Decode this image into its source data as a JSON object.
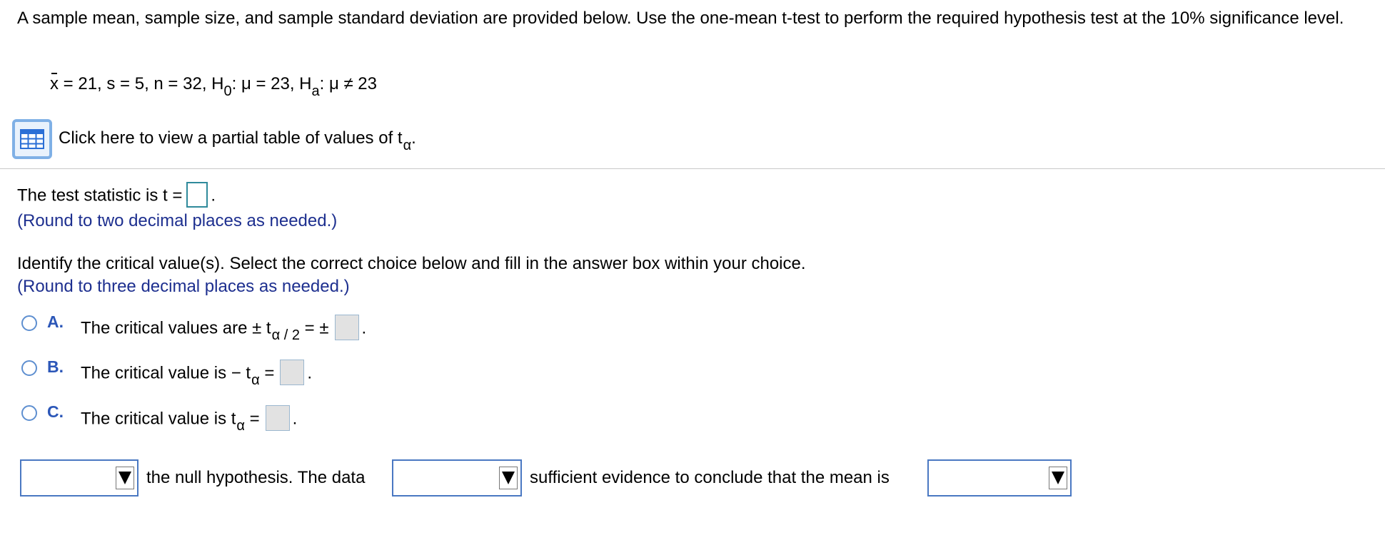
{
  "problem": {
    "intro": "A sample mean, sample size, and sample standard deviation are provided below. Use the one-mean t-test to perform the required hypothesis test at the 10% significance level.",
    "given": {
      "xbar_symbol": "x",
      "part1": " = 21, s = 5, n = 32, H",
      "h0_sub": "0",
      "part2": ": μ = 23, H",
      "ha_sub": "a",
      "part3": ": μ ≠ 23"
    },
    "table_link": {
      "text": "Click here to view a partial table of values of t",
      "sub": "α",
      "suffix": "."
    }
  },
  "test_statistic": {
    "label": "The test statistic is t =",
    "suffix": ".",
    "value": "",
    "round_note": "(Round to two decimal places as needed.)"
  },
  "critical": {
    "question": "Identify the critical value(s). Select the correct choice below and fill in the answer box within your choice.",
    "round_note": "(Round to three decimal places as needed.)",
    "choices": [
      {
        "letter": "A.",
        "text": "The critical values are  ± t",
        "sub": "α / 2",
        "after": " = ±",
        "suffix": "."
      },
      {
        "letter": "B.",
        "text": "The critical value is  − t",
        "sub": "α",
        "after": " =",
        "suffix": "."
      },
      {
        "letter": "C.",
        "text": "The critical value is t",
        "sub": "α",
        "after": " =",
        "suffix": "."
      }
    ]
  },
  "conclusion": {
    "segment1": "the null hypothesis. The data",
    "segment2": "sufficient evidence to conclude that the mean is",
    "dropdown1": "",
    "dropdown2": "",
    "dropdown3": ""
  },
  "colors": {
    "note_blue": "#1d2f8f",
    "radio_border": "#5e8fd0",
    "choice_letter": "#2c57b8",
    "answer_box_border": "#2f8a9b",
    "dropdown_border": "#4a78c2"
  }
}
